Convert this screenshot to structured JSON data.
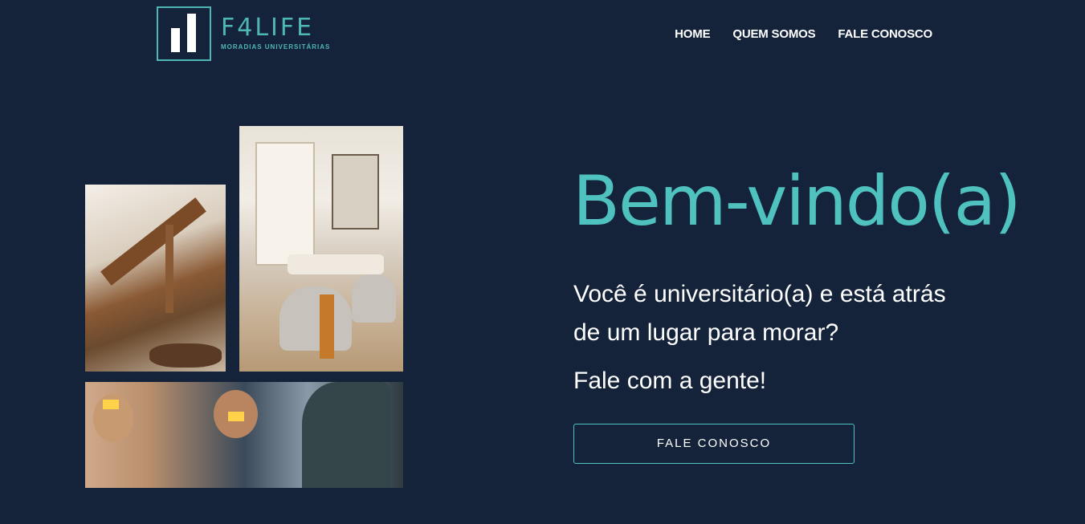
{
  "logo": {
    "title": "F4LIFE",
    "subtitle": "MORADIAS UNIVERSITÁRIAS"
  },
  "nav": {
    "items": [
      {
        "label": "HOME"
      },
      {
        "label": "QUEM SOMOS"
      },
      {
        "label": "FALE CONOSCO"
      }
    ]
  },
  "hero": {
    "title": "Bem-vindo(a)",
    "text": "Você é universitário(a) e está atrás de um lugar para morar?",
    "cta_text": "Fale com a gente!",
    "button_label": "FALE CONOSCO"
  },
  "colors": {
    "background": "#14233a",
    "accent": "#4fc2c0",
    "text": "#ffffff"
  }
}
